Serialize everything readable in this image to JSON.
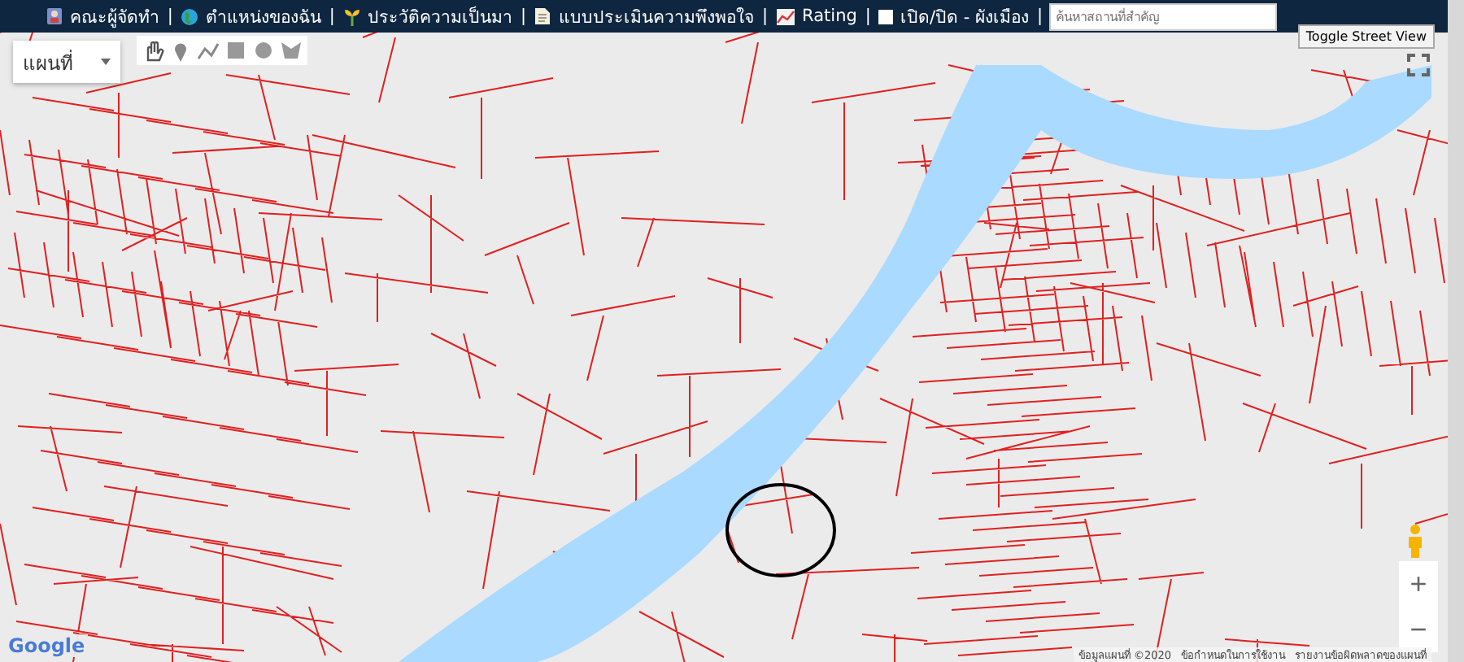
{
  "nav": {
    "items": [
      {
        "kind": "link",
        "label": "คณะผู้จัดทำ"
      },
      {
        "kind": "separator",
        "label": "|"
      },
      {
        "kind": "link",
        "label": "ตำแหน่งของฉัน"
      },
      {
        "kind": "separator",
        "label": "|"
      },
      {
        "kind": "link",
        "label": "ประวัติความเป็นมา"
      },
      {
        "kind": "separator",
        "label": "|"
      },
      {
        "kind": "link",
        "label": "แบบประเมินความพึงพอใจ"
      },
      {
        "kind": "separator",
        "label": "|"
      },
      {
        "kind": "link",
        "label": "Rating"
      },
      {
        "kind": "separator",
        "label": "|"
      },
      {
        "kind": "checkbox",
        "checked": false,
        "label": "เปิด/ปิด - ผังเมือง"
      },
      {
        "kind": "separator",
        "label": "|"
      }
    ],
    "search": {
      "placeholder": "ค้นหาสถานที่สำคัญ"
    }
  },
  "map": {
    "map_type": {
      "value": "แผนที่"
    },
    "street_view_button": "Toggle Street View",
    "zoom_in": "+",
    "zoom_out": "−",
    "logo": "Google",
    "attribution": [
      "ข้อมูลแผนที่ ©2020",
      "ข้อกำหนดในการใช้งาน",
      "รายงานข้อผิดพลาดของแผนที่"
    ]
  }
}
